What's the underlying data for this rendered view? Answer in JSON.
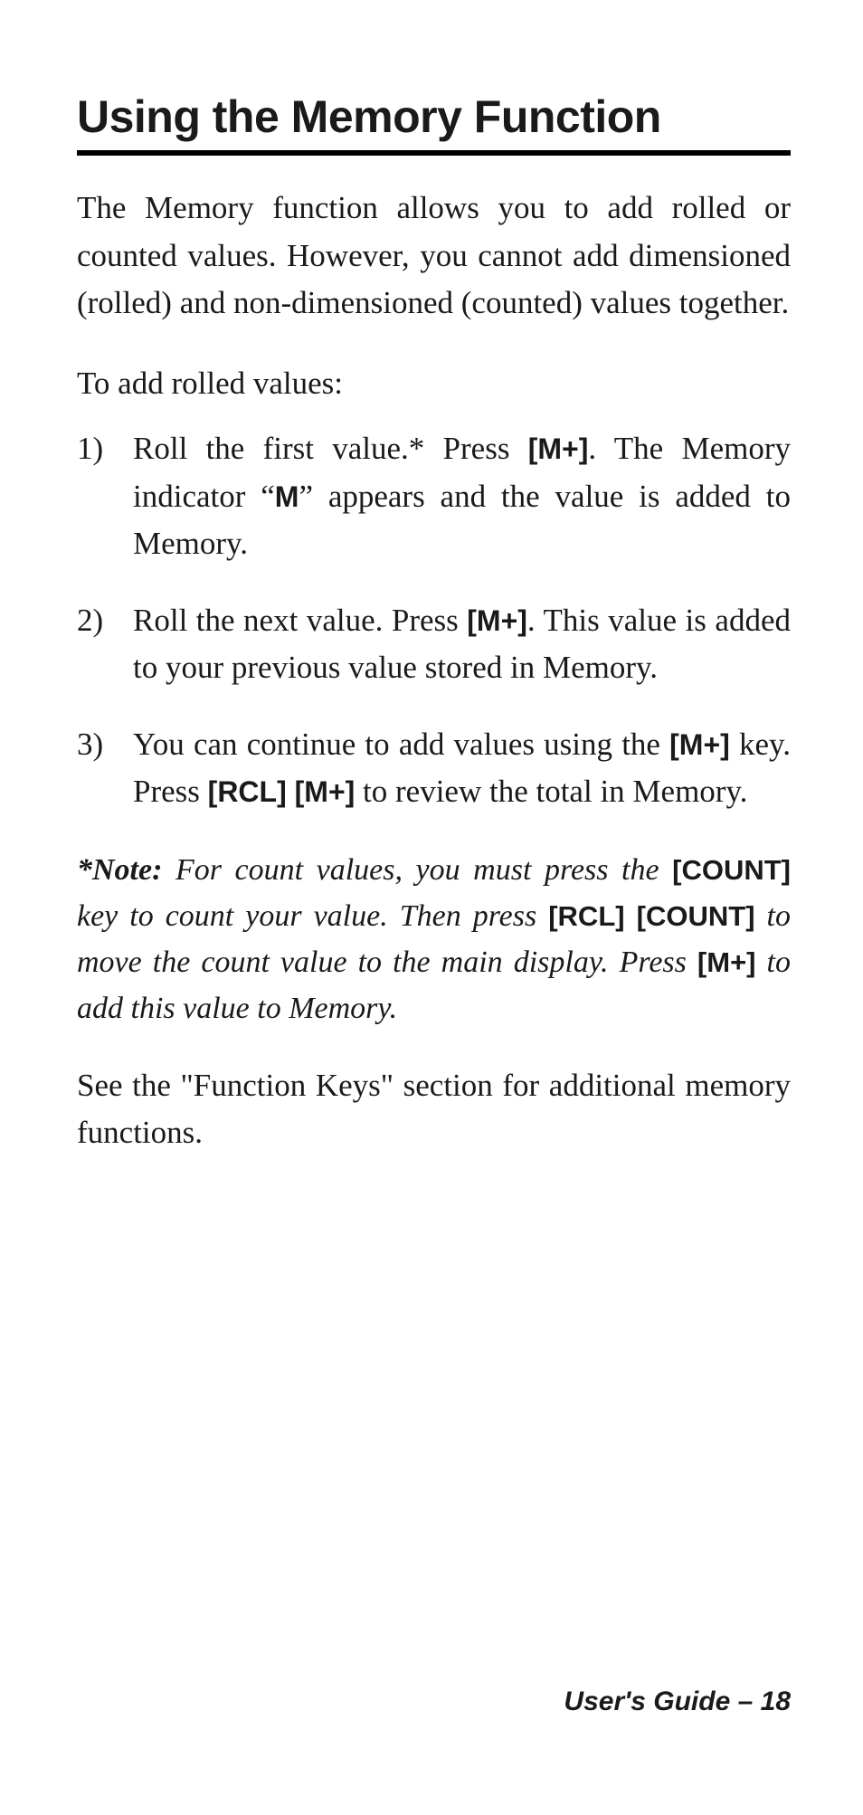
{
  "heading": "Using the Memory Function",
  "intro": "The Memory function allows you to add rolled or counted values. However, you cannot add dimensioned (rolled) and non-dimensioned (counted) values together.",
  "sub_heading": "To add rolled values:",
  "steps": [
    {
      "marker": "1)",
      "pre": "Roll the first value.* Press ",
      "key1": "[M+]",
      "mid1": ". The Memory indicator “",
      "mem": "M",
      "mid2": "” appears and the value is added to Memory."
    },
    {
      "marker": "2)",
      "pre": "Roll the next value. Press ",
      "key1": "[M+]",
      "mid1": ". This value is added to your previous value stored in Memory."
    },
    {
      "marker": "3)",
      "pre": "You can continue to add values using the ",
      "key1": "[M+]",
      "mid1": " key. Press ",
      "key2": "[RCL] [M+]",
      "mid2": " to review the total in Memory."
    }
  ],
  "note": {
    "label": "*Note:",
    "t1": " For count values, you must press the ",
    "k1": "[COUNT]",
    "t2": " key to count your value. Then press ",
    "k2": "[RCL] [COUNT]",
    "t3": " to move the count value to the main display. Press ",
    "k3": "[M+]",
    "t4": " to add this value to Memory."
  },
  "closing": "See the \"Function Keys\" section for additional memory functions.",
  "footer": "User's Guide – 18"
}
